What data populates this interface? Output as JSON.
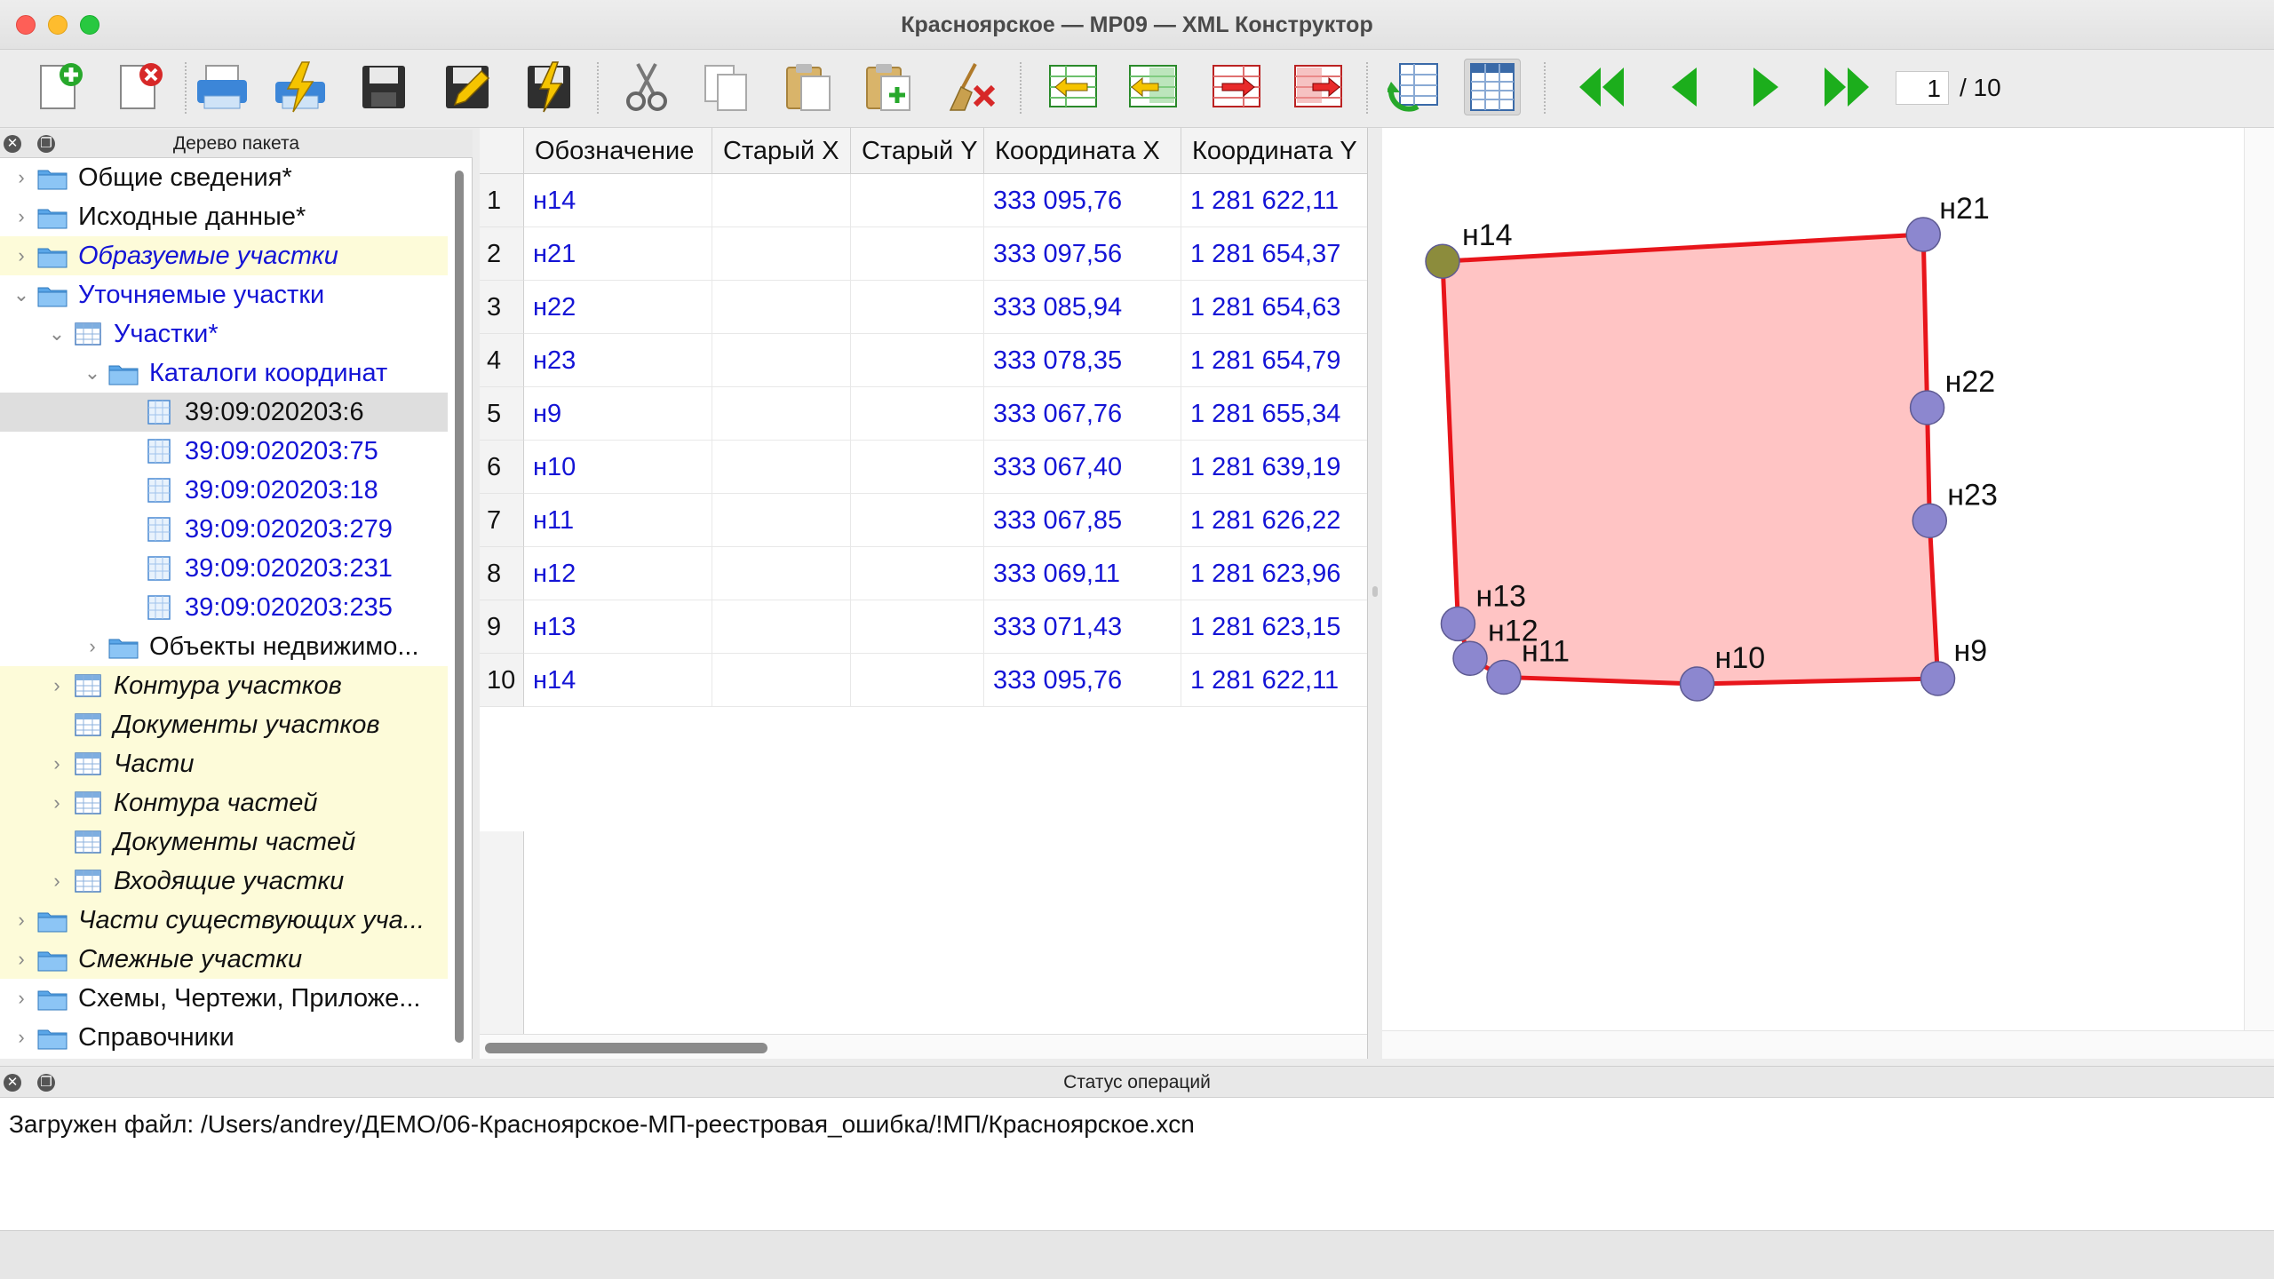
{
  "window": {
    "title": "Красноярское — МР09 — XML Конструктор"
  },
  "toolbar": {
    "buttons": [
      {
        "name": "new-document-icon"
      },
      {
        "name": "delete-document-icon"
      },
      {
        "name": "print-icon"
      },
      {
        "name": "print-quick-icon"
      },
      {
        "name": "save-icon"
      },
      {
        "name": "save-edit-icon"
      },
      {
        "name": "save-quick-icon"
      },
      {
        "name": "cut-icon"
      },
      {
        "name": "copy-icon"
      },
      {
        "name": "paste-icon"
      },
      {
        "name": "paste-new-icon"
      },
      {
        "name": "clear-icon"
      },
      {
        "name": "import-left-icon"
      },
      {
        "name": "import-list-icon"
      },
      {
        "name": "export-right-icon"
      },
      {
        "name": "export-list-icon"
      },
      {
        "name": "refresh-table-icon"
      },
      {
        "name": "table-view-icon"
      },
      {
        "name": "first-page-icon"
      },
      {
        "name": "prev-page-icon"
      },
      {
        "name": "next-page-icon"
      },
      {
        "name": "last-page-icon"
      }
    ],
    "page_current": "1",
    "page_total": "/ 10",
    "colors": {
      "green_nav": "#1cae1c"
    }
  },
  "tree_panel": {
    "title": "Дерево пакета",
    "items": [
      {
        "label": "Общие сведения*"
      },
      {
        "label": "Исходные данные*"
      },
      {
        "label": "Образуемые участки"
      },
      {
        "label": "Уточняемые участки"
      },
      {
        "label": "Участки*"
      },
      {
        "label": "Каталоги координат"
      },
      {
        "label": "39:09:020203:6"
      },
      {
        "label": "39:09:020203:75"
      },
      {
        "label": "39:09:020203:18"
      },
      {
        "label": "39:09:020203:279"
      },
      {
        "label": "39:09:020203:231"
      },
      {
        "label": "39:09:020203:235"
      },
      {
        "label": "Объекты недвижимо..."
      },
      {
        "label": "Контура участков"
      },
      {
        "label": "Документы участков"
      },
      {
        "label": "Части"
      },
      {
        "label": "Контура частей"
      },
      {
        "label": "Документы частей"
      },
      {
        "label": "Входящие участки"
      },
      {
        "label": "Части существующих уча..."
      },
      {
        "label": "Смежные участки"
      },
      {
        "label": "Схемы, Чертежи, Приложе..."
      },
      {
        "label": "Справочники"
      }
    ]
  },
  "table": {
    "columns": [
      "Обозначение",
      "Старый X",
      "Старый Y",
      "Координата X",
      "Координата Y"
    ],
    "rows": [
      {
        "n": "1",
        "name": "н14",
        "old_x": "",
        "old_y": "",
        "x": "333 095,76",
        "y": "1 281 622,11"
      },
      {
        "n": "2",
        "name": "н21",
        "old_x": "",
        "old_y": "",
        "x": "333 097,56",
        "y": "1 281 654,37"
      },
      {
        "n": "3",
        "name": "н22",
        "old_x": "",
        "old_y": "",
        "x": "333 085,94",
        "y": "1 281 654,63"
      },
      {
        "n": "4",
        "name": "н23",
        "old_x": "",
        "old_y": "",
        "x": "333 078,35",
        "y": "1 281 654,79"
      },
      {
        "n": "5",
        "name": "н9",
        "old_x": "",
        "old_y": "",
        "x": "333 067,76",
        "y": "1 281 655,34"
      },
      {
        "n": "6",
        "name": "н10",
        "old_x": "",
        "old_y": "",
        "x": "333 067,40",
        "y": "1 281 639,19"
      },
      {
        "n": "7",
        "name": "н11",
        "old_x": "",
        "old_y": "",
        "x": "333 067,85",
        "y": "1 281 626,22"
      },
      {
        "n": "8",
        "name": "н12",
        "old_x": "",
        "old_y": "",
        "x": "333 069,11",
        "y": "1 281 623,96"
      },
      {
        "n": "9",
        "name": "н13",
        "old_x": "",
        "old_y": "",
        "x": "333 071,43",
        "y": "1 281 623,15"
      },
      {
        "n": "10",
        "name": "н14",
        "old_x": "",
        "old_y": "",
        "x": "333 095,76",
        "y": "1 281 622,11"
      }
    ]
  },
  "map": {
    "points": [
      {
        "label": "н14",
        "x": 333095.76,
        "y": 1281622.11,
        "start": true
      },
      {
        "label": "н21",
        "x": 333097.56,
        "y": 1281654.37
      },
      {
        "label": "н22",
        "x": 333085.94,
        "y": 1281654.63
      },
      {
        "label": "н23",
        "x": 333078.35,
        "y": 1281654.79
      },
      {
        "label": "н9",
        "x": 333067.76,
        "y": 1281655.34
      },
      {
        "label": "н10",
        "x": 333067.4,
        "y": 1281639.19
      },
      {
        "label": "н11",
        "x": 333067.85,
        "y": 1281626.22
      },
      {
        "label": "н12",
        "x": 333069.11,
        "y": 1281623.96
      },
      {
        "label": "н13",
        "x": 333071.43,
        "y": 1281623.15
      }
    ],
    "colors": {
      "fill": "#ffc4c4",
      "stroke": "#e8151b",
      "vertex": "#8c87cf",
      "vertex_start": "#8c8c3c"
    }
  },
  "status_panel": {
    "title": "Статус операций",
    "message": "Загружен файл: /Users/andrey/ДЕМО/06-Красноярское-МП-реестровая_ошибка/!МП/Красноярское.xcn"
  }
}
